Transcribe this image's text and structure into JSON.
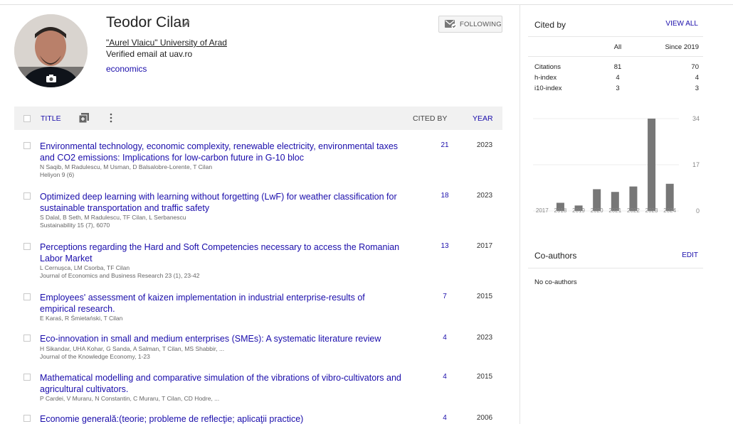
{
  "profile": {
    "name": "Teodor Cilan",
    "affiliation": "\"Aurel Vlaicu\" University of Arad",
    "email": "Verified email at uav.ro",
    "interest": "economics",
    "follow_label": "FOLLOWING"
  },
  "table": {
    "title_header": "TITLE",
    "cited_header": "CITED BY",
    "year_header": "YEAR"
  },
  "articles": [
    {
      "title": "Environmental technology, economic complexity, renewable electricity, environmental taxes and CO2 emissions: Implications for low-carbon future in G-10 bloc",
      "authors": "N Saqib, M Radulescu, M Usman, D Balsalobre-Lorente, T Cilan",
      "venue": "Heliyon 9 (6)",
      "cited_by": "21",
      "year": "2023"
    },
    {
      "title": "Optimized deep learning with learning without forgetting (LwF) for weather classification for sustainable transportation and traffic safety",
      "authors": "S Dalal, B Seth, M Radulescu, TF Cilan, L Serbanescu",
      "venue": "Sustainability 15 (7), 6070",
      "cited_by": "18",
      "year": "2023"
    },
    {
      "title": "Perceptions regarding the Hard and Soft Competencies necessary to access the Romanian Labor Market",
      "authors": "L Cernușca, LM Csorba, TF Cilan",
      "venue": "Journal of Economics and Business Research 23 (1), 23-42",
      "cited_by": "13",
      "year": "2017"
    },
    {
      "title": "Employees' assessment of kaizen implementation in industrial enterprise-results of empirical research.",
      "authors": "E Karaś, R Śmietański, T Cilan",
      "venue": "",
      "cited_by": "7",
      "year": "2015"
    },
    {
      "title": "Eco-innovation in small and medium enterprises (SMEs): A systematic literature review",
      "authors": "H Sikandar, UHA Kohar, G Sanda, A Salman, T Cilan, MS Shabbir, ...",
      "venue": "Journal of the Knowledge Economy, 1-23",
      "cited_by": "4",
      "year": "2023"
    },
    {
      "title": "Mathematical modelling and comparative simulation of the vibrations of vibro-cultivators and agricultural cultivators.",
      "authors": "P Cardei, V Muraru, N Constantin, C Muraru, T Cilan, CD Hodre, ...",
      "venue": "",
      "cited_by": "4",
      "year": "2015"
    },
    {
      "title": "Economie generală:(teorie; probleme de reflecţie; aplicaţii practice)",
      "authors": "",
      "venue": "",
      "cited_by": "4",
      "year": "2006"
    }
  ],
  "cited_by": {
    "title": "Cited by",
    "view_all": "VIEW ALL",
    "col_all": "All",
    "col_since": "Since 2019",
    "rows": [
      {
        "label": "Citations",
        "all": "81",
        "since": "70"
      },
      {
        "label": "h-index",
        "all": "4",
        "since": "4"
      },
      {
        "label": "i10-index",
        "all": "3",
        "since": "3"
      }
    ]
  },
  "chart_data": {
    "type": "bar",
    "categories": [
      "2017",
      "2018",
      "2019",
      "2020",
      "2021",
      "2022",
      "2023",
      "2024"
    ],
    "values": [
      0,
      3,
      2,
      8,
      7,
      9,
      34,
      10
    ],
    "ylim": [
      0,
      34
    ],
    "yticks": [
      "34",
      "17",
      "0"
    ],
    "grid": true,
    "bar_color": "#777777"
  },
  "coauthors": {
    "title": "Co-authors",
    "edit": "EDIT",
    "none": "No co-authors"
  }
}
